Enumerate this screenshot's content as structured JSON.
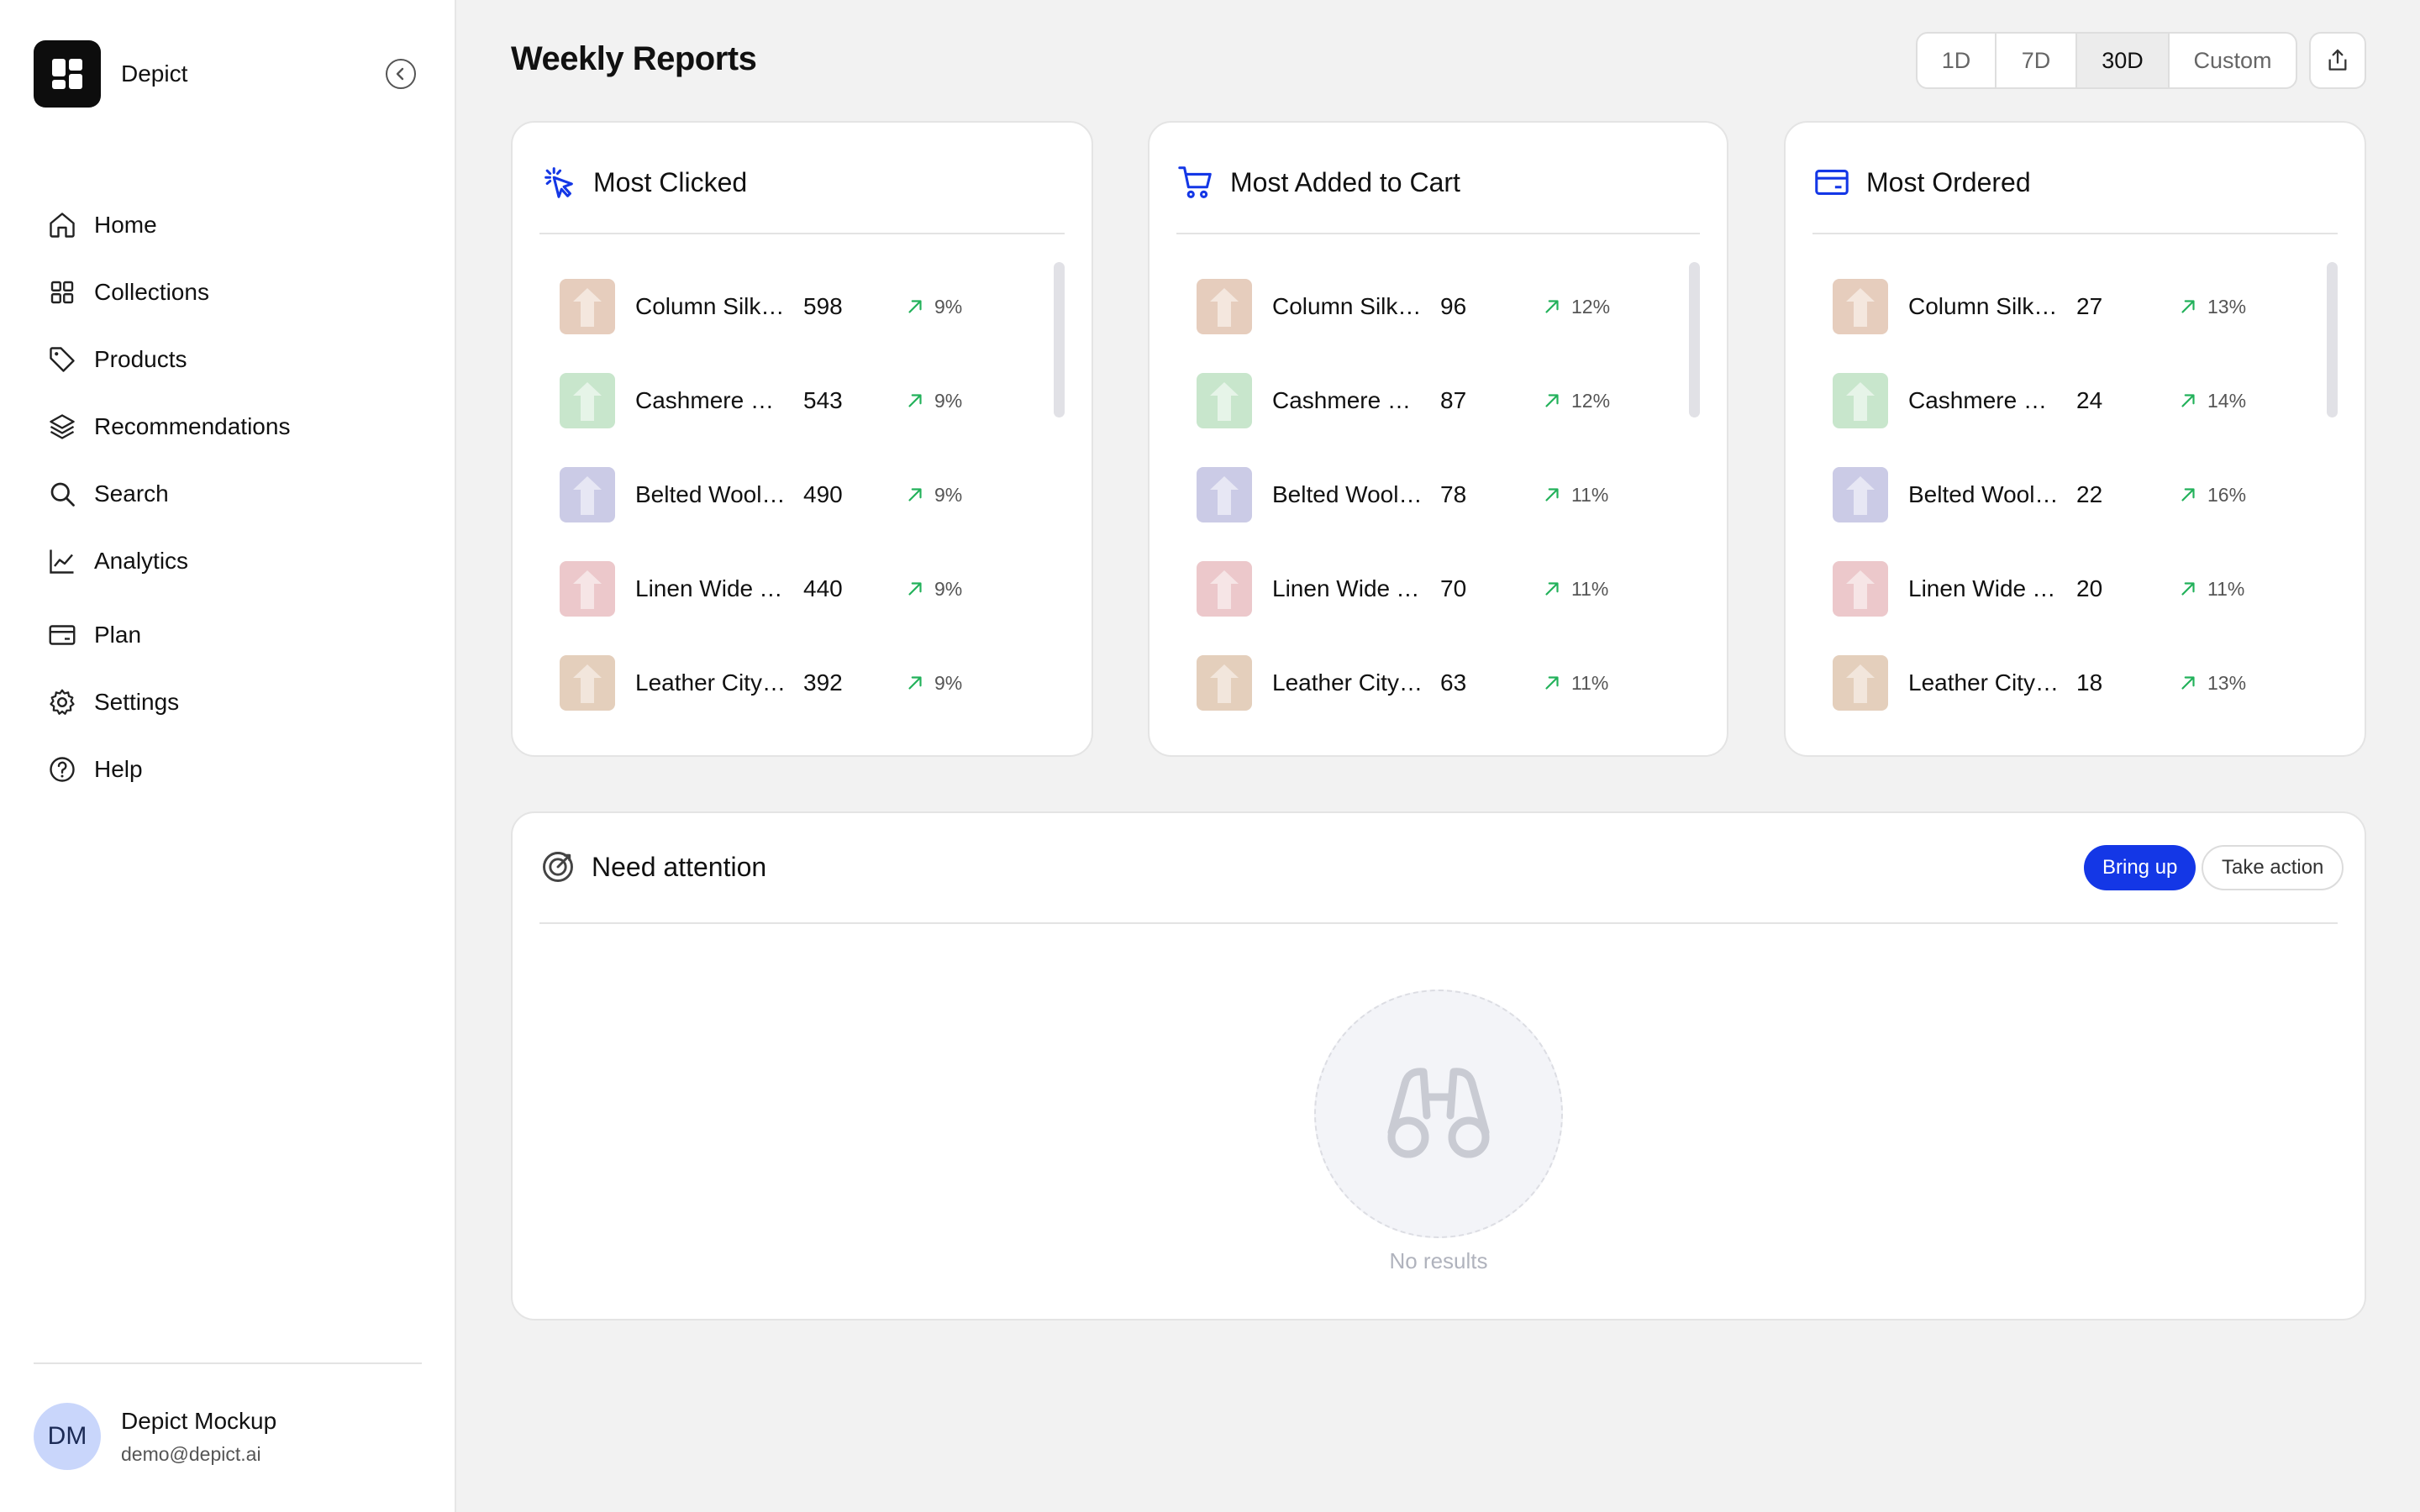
{
  "brand": {
    "name": "Depict"
  },
  "nav": [
    {
      "label": "Home",
      "icon": "home-icon"
    },
    {
      "label": "Collections",
      "icon": "grid-icon"
    },
    {
      "label": "Products",
      "icon": "tag-icon"
    },
    {
      "label": "Recommendations",
      "icon": "layers-icon"
    },
    {
      "label": "Search",
      "icon": "search-icon"
    },
    {
      "label": "Analytics",
      "icon": "chart-line-icon"
    },
    {
      "label": "Plan",
      "icon": "card-icon"
    },
    {
      "label": "Settings",
      "icon": "gear-icon"
    },
    {
      "label": "Help",
      "icon": "help-circle-icon"
    }
  ],
  "user": {
    "initials": "DM",
    "name": "Depict Mockup",
    "email": "demo@depict.ai"
  },
  "header": {
    "title": "Weekly Reports",
    "ranges": [
      "1D",
      "7D",
      "30D",
      "Custom"
    ],
    "active_range": "30D"
  },
  "cards": [
    {
      "title": "Most Clicked",
      "icon": "cursor-click-icon",
      "rows": [
        {
          "name": "Column Silk Dress",
          "value": "598",
          "change": "9%"
        },
        {
          "name": "Cashmere Sweater",
          "value": "543",
          "change": "9%"
        },
        {
          "name": "Belted Wool Coat",
          "value": "490",
          "change": "9%"
        },
        {
          "name": "Linen Wide Trousers",
          "value": "440",
          "change": "9%"
        },
        {
          "name": "Leather City Bag",
          "value": "392",
          "change": "9%"
        }
      ]
    },
    {
      "title": "Most Added to Cart",
      "icon": "cart-icon",
      "rows": [
        {
          "name": "Column Silk Dress",
          "value": "96",
          "change": "12%"
        },
        {
          "name": "Cashmere Sweater",
          "value": "87",
          "change": "12%"
        },
        {
          "name": "Belted Wool Coat",
          "value": "78",
          "change": "11%"
        },
        {
          "name": "Linen Wide Trousers",
          "value": "70",
          "change": "11%"
        },
        {
          "name": "Leather City Bag",
          "value": "63",
          "change": "11%"
        }
      ]
    },
    {
      "title": "Most Ordered",
      "icon": "credit-card-icon",
      "rows": [
        {
          "name": "Column Silk Dress",
          "value": "27",
          "change": "13%"
        },
        {
          "name": "Cashmere Sweater",
          "value": "24",
          "change": "14%"
        },
        {
          "name": "Belted Wool Coat",
          "value": "22",
          "change": "16%"
        },
        {
          "name": "Linen Wide Trousers",
          "value": "20",
          "change": "11%"
        },
        {
          "name": "Leather City Bag",
          "value": "18",
          "change": "13%"
        }
      ]
    }
  ],
  "attention": {
    "title": "Need attention",
    "bring_up": "Bring up",
    "take_action": "Take action",
    "empty_text": "No results"
  },
  "colors": {
    "accent": "#1437e6",
    "trend_up": "#22b15a",
    "thumb_tan": "#e6cdbd",
    "thumb_green": "#c8e6cc",
    "thumb_lavender": "#cbcbe6",
    "thumb_pink": "#ecc8cb",
    "thumb_beige": "#e4cfbc"
  }
}
